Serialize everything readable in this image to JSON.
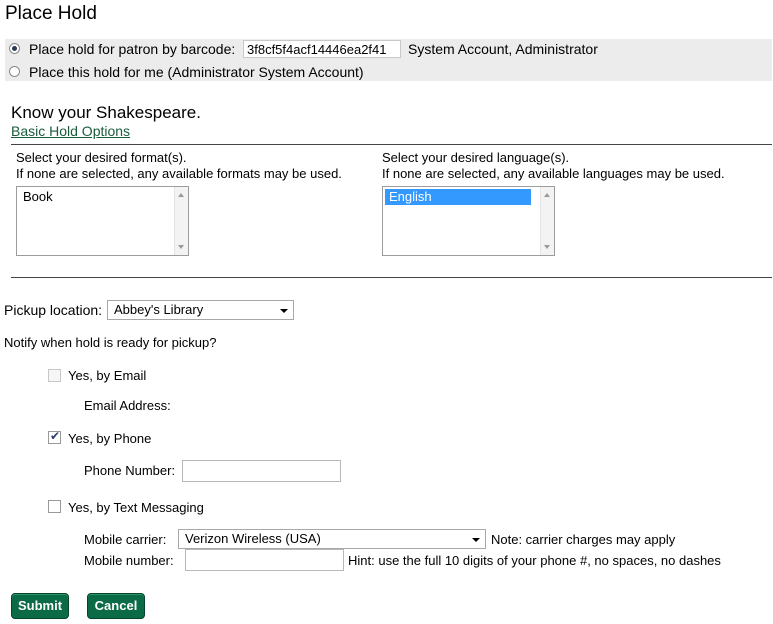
{
  "page": {
    "title": "Place Hold"
  },
  "patron": {
    "barcode_label": "Place hold for patron by barcode:",
    "barcode_value": "3f8cf5f4acf14446ea2f41",
    "patron_name": "System Account, Administrator",
    "self_label": "Place this hold for me (Administrator System Account)"
  },
  "item": {
    "title": "Know your Shakespeare.",
    "basic_options_link": "Basic Hold Options"
  },
  "format": {
    "prompt1": "Select your desired format(s).",
    "prompt2": "If none are selected, any available formats may be used.",
    "options": [
      "Book"
    ]
  },
  "language": {
    "prompt1": "Select your desired language(s).",
    "prompt2": "If none are selected, any available languages may be used.",
    "options": [
      "English"
    ]
  },
  "pickup": {
    "label": "Pickup location:",
    "value": "Abbey's Library"
  },
  "notify": {
    "label": "Notify when hold is ready for pickup?",
    "email_label": "Yes, by Email",
    "email_address_label": "Email Address:",
    "phone_label": "Yes, by Phone",
    "phone_number_label": "Phone Number:",
    "text_label": "Yes, by Text Messaging",
    "carrier_label": "Mobile carrier:",
    "carrier_value": "Verizon Wireless (USA)",
    "carrier_note": "Note: carrier charges may apply",
    "mobile_label": "Mobile number:",
    "mobile_hint": "Hint: use the full 10 digits of your phone #, no spaces, no dashes"
  },
  "actions": {
    "submit": "Submit",
    "cancel": "Cancel"
  }
}
